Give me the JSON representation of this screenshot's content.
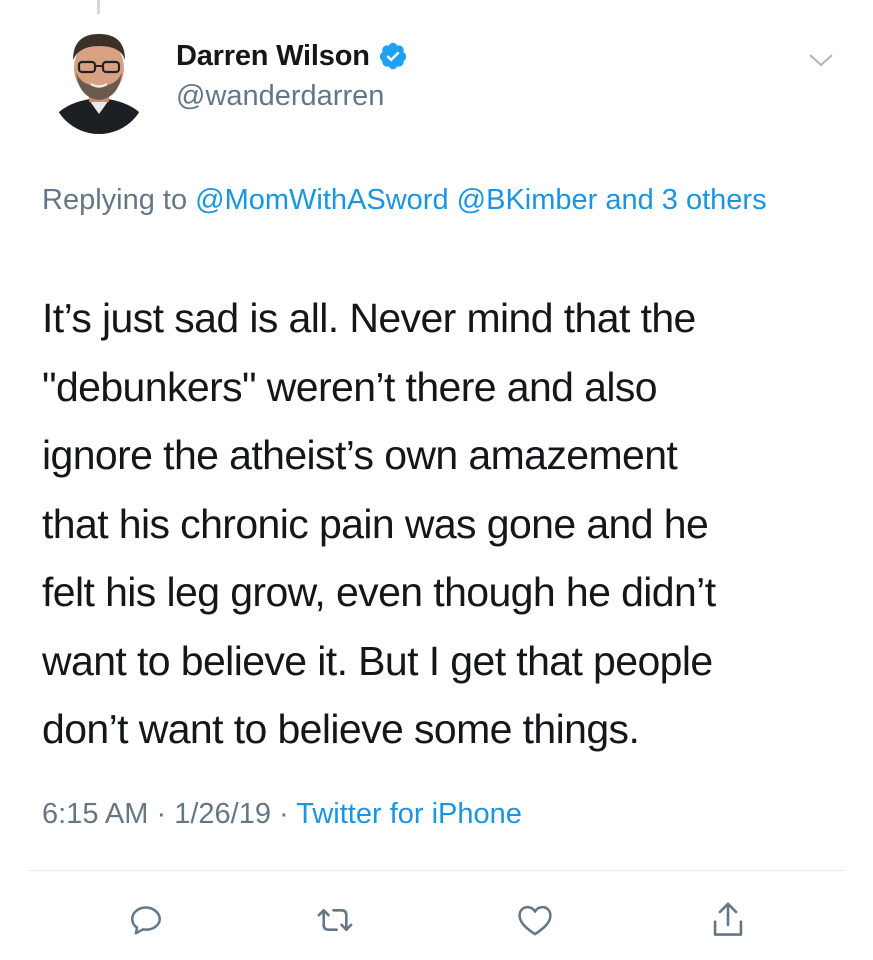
{
  "tweet": {
    "author": {
      "display_name": "Darren Wilson",
      "handle": "@wanderdarren",
      "verified": true
    },
    "reply_to": {
      "prefix": "Replying to",
      "mentions": [
        "@MomWithASword",
        "@BKimber"
      ],
      "others": "and 3 others"
    },
    "text_lines": [
      "It’s just sad is all. Never mind that the",
      "\"debunkers\" weren’t there and also",
      "ignore the atheist’s own amazement",
      "that his chronic pain was gone and he",
      "felt his leg grow, even though he didn’t",
      "want to believe it. But I get that people",
      "don’t want to believe some things."
    ],
    "time": "6:15 AM",
    "date": "1/26/19",
    "separator": "·",
    "source": "Twitter for iPhone"
  },
  "icons": {
    "more": "chevron-down-icon",
    "reply": "reply-icon",
    "retweet": "retweet-icon",
    "like": "heart-icon",
    "share": "share-icon",
    "verified": "verified-badge-icon"
  },
  "colors": {
    "text_primary": "#14171a",
    "text_secondary": "#657786",
    "link": "#1b95e0",
    "verified": "#1da1f2",
    "divider": "#e6ecf0"
  }
}
